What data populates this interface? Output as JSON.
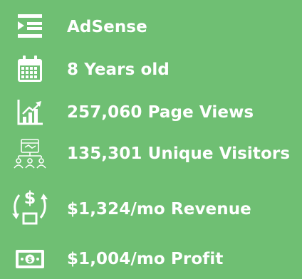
{
  "listing_stats": {
    "items": [
      {
        "icon": "list-menu-icon",
        "label": "AdSense"
      },
      {
        "icon": "calendar-icon",
        "label": "8 Years old"
      },
      {
        "icon": "growth-chart-icon",
        "label": "257,060 Page Views"
      },
      {
        "icon": "visitors-network-icon",
        "label": "135,301 Unique Visitors"
      },
      {
        "icon": "revenue-cycle-icon",
        "label": "$1,324/mo Revenue"
      },
      {
        "icon": "cash-bill-icon",
        "label": "$1,004/mo Profit"
      }
    ]
  },
  "colors": {
    "background": "#6fbf73",
    "foreground": "#ffffff"
  }
}
